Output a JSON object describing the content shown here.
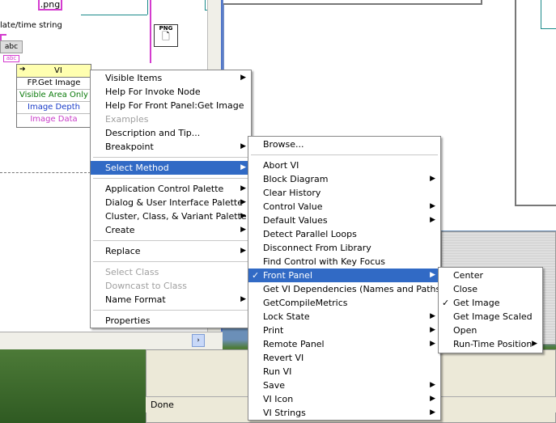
{
  "block_diagram": {
    "png_label": ".png",
    "date_time_label": "late/time string",
    "abc_label": "abc",
    "abc_small_label": "abc",
    "png_node_label": "PNG",
    "invoke_node": {
      "header": "VI",
      "rows": [
        "FP.Get Image",
        "Visible Area Only",
        "Image Depth",
        "Image Data"
      ],
      "row_colors": [
        "#000000",
        "#0a7a0a",
        "#1a3cc8",
        "#c83cc8"
      ]
    }
  },
  "status_bar": {
    "text": "Done"
  },
  "context_menu_1": {
    "items": [
      {
        "label": "Visible Items",
        "submenu": true,
        "disabled": false
      },
      {
        "label": "Help For Invoke Node",
        "submenu": false,
        "disabled": false
      },
      {
        "label": "Help For Front Panel:Get Image",
        "submenu": false,
        "disabled": false
      },
      {
        "label": "Examples",
        "submenu": false,
        "disabled": true
      },
      {
        "label": "Description and Tip...",
        "submenu": false,
        "disabled": false
      },
      {
        "label": "Breakpoint",
        "submenu": true,
        "disabled": false
      },
      {
        "separator": true
      },
      {
        "label": "Select Method",
        "submenu": true,
        "disabled": false,
        "selected": true
      },
      {
        "separator": true
      },
      {
        "label": "Application Control Palette",
        "submenu": true,
        "disabled": false
      },
      {
        "label": "Dialog & User Interface Palette",
        "submenu": true,
        "disabled": false
      },
      {
        "label": "Cluster, Class, & Variant Palette",
        "submenu": true,
        "disabled": false
      },
      {
        "label": "Create",
        "submenu": true,
        "disabled": false
      },
      {
        "separator": true
      },
      {
        "label": "Replace",
        "submenu": true,
        "disabled": false
      },
      {
        "separator": true
      },
      {
        "label": "Select Class",
        "submenu": false,
        "disabled": true
      },
      {
        "label": "Downcast to Class",
        "submenu": false,
        "disabled": true
      },
      {
        "label": "Name Format",
        "submenu": true,
        "disabled": false
      },
      {
        "separator": true
      },
      {
        "label": "Properties",
        "submenu": false,
        "disabled": false
      }
    ]
  },
  "context_menu_2": {
    "items": [
      {
        "label": "Browse...",
        "submenu": false
      },
      {
        "separator": true
      },
      {
        "label": "Abort VI",
        "submenu": false
      },
      {
        "label": "Block Diagram",
        "submenu": true
      },
      {
        "label": "Clear History",
        "submenu": false
      },
      {
        "label": "Control Value",
        "submenu": true
      },
      {
        "label": "Default Values",
        "submenu": true
      },
      {
        "label": "Detect Parallel Loops",
        "submenu": false
      },
      {
        "label": "Disconnect From Library",
        "submenu": false
      },
      {
        "label": "Find Control with Key Focus",
        "submenu": false
      },
      {
        "label": "Front Panel",
        "submenu": true,
        "checked": true,
        "selected": true
      },
      {
        "label": "Get VI Dependencies (Names and Paths)",
        "submenu": false
      },
      {
        "label": "GetCompileMetrics",
        "submenu": false
      },
      {
        "label": "Lock State",
        "submenu": true
      },
      {
        "label": "Print",
        "submenu": true
      },
      {
        "label": "Remote Panel",
        "submenu": true
      },
      {
        "label": "Revert VI",
        "submenu": false
      },
      {
        "label": "Run VI",
        "submenu": false
      },
      {
        "label": "Save",
        "submenu": true
      },
      {
        "label": "VI Icon",
        "submenu": true
      },
      {
        "label": "VI Strings",
        "submenu": true
      }
    ]
  },
  "context_menu_3": {
    "items": [
      {
        "label": "Center",
        "submenu": false
      },
      {
        "label": "Close",
        "submenu": false
      },
      {
        "label": "Get Image",
        "submenu": false,
        "checked": true
      },
      {
        "label": "Get Image Scaled",
        "submenu": false
      },
      {
        "label": "Open",
        "submenu": false
      },
      {
        "label": "Run-Time Position",
        "submenu": true
      }
    ]
  },
  "glyphs": {
    "arrow": "▶",
    "check": "✓",
    "scroll_right": "›"
  }
}
